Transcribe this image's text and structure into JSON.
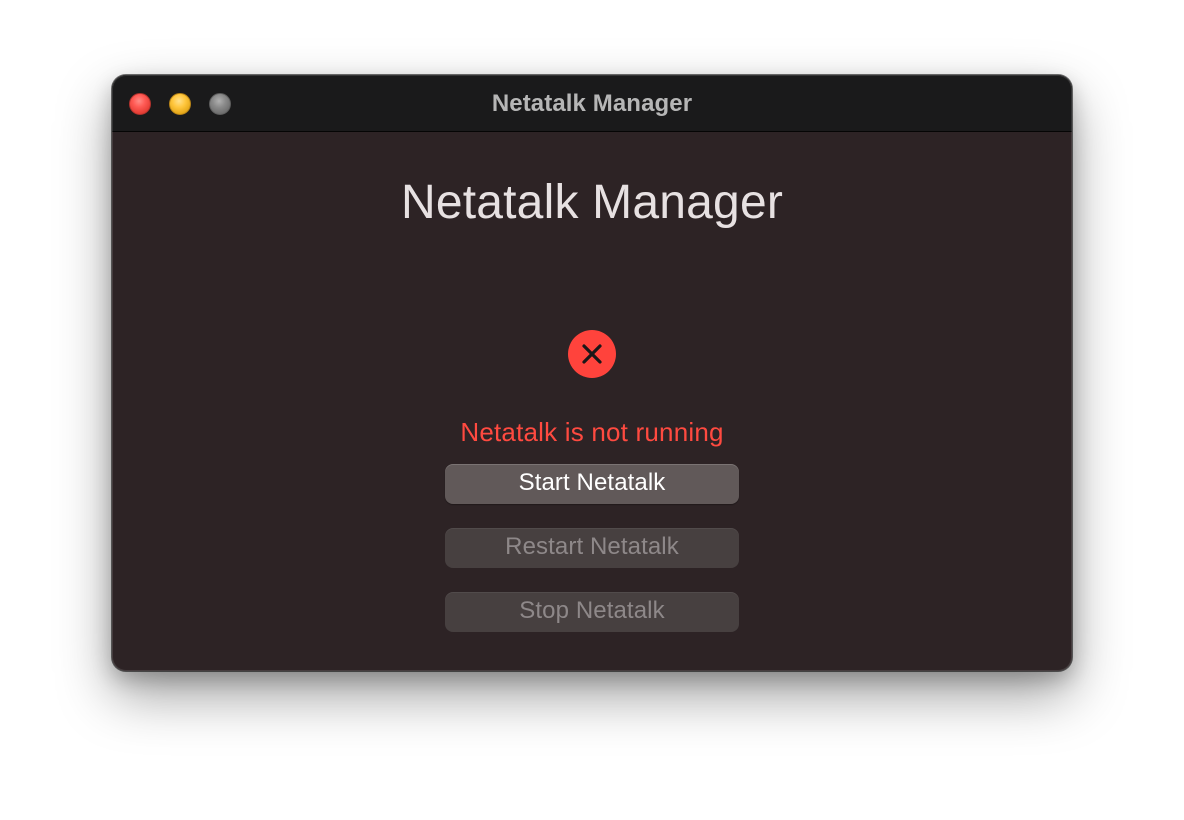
{
  "window": {
    "title": "Netatalk Manager",
    "background_color": "#2d2325",
    "titlebar_color": "#1a1a1b"
  },
  "titlebar": {
    "controls": [
      {
        "name": "close",
        "icon": "close-window-icon",
        "color": "#ff5f57"
      },
      {
        "name": "minimize",
        "icon": "minimize-window-icon",
        "color": "#ffbd2e"
      },
      {
        "name": "zoom",
        "icon": "zoom-window-icon",
        "color": "#8a8a8a"
      }
    ]
  },
  "main": {
    "heading": "Netatalk Manager",
    "status": {
      "icon": "close-circle-icon",
      "icon_color": "#ff433c",
      "text": "Netatalk is not running",
      "text_color": "#ff4a40"
    },
    "buttons": [
      {
        "label": "Start Netatalk",
        "enabled": true
      },
      {
        "label": "Restart Netatalk",
        "enabled": false
      },
      {
        "label": "Stop Netatalk",
        "enabled": false
      }
    ]
  }
}
